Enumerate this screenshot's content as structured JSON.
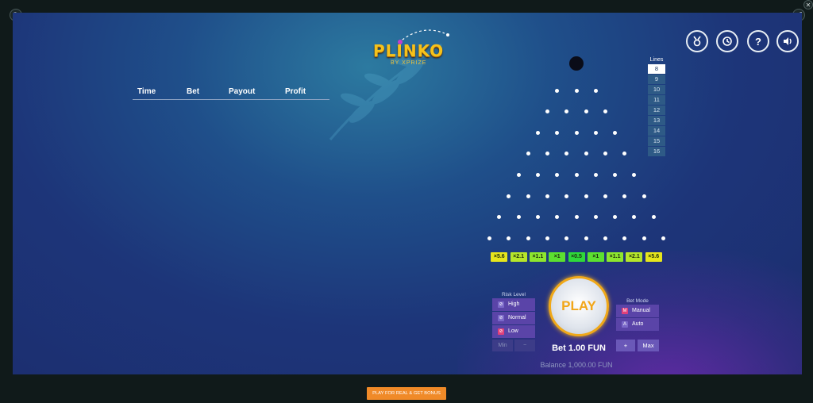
{
  "logo": {
    "title": "PLINKO",
    "subtitle": "BY XPRIZE"
  },
  "history": {
    "columns": [
      "Time",
      "Bet",
      "Payout",
      "Profit"
    ]
  },
  "hud": {
    "achievements": "medal-icon",
    "history": "clock-icon",
    "help": "?",
    "sound": "speaker-icon"
  },
  "lines": {
    "title": "Lines",
    "options": [
      "8",
      "9",
      "10",
      "11",
      "12",
      "13",
      "14",
      "15",
      "16"
    ],
    "selected": "8"
  },
  "board": {
    "rows": 8,
    "multipliers": [
      "×5.6",
      "×2.1",
      "×1.1",
      "×1",
      "×0.5",
      "×1",
      "×1.1",
      "×2.1",
      "×5.6"
    ],
    "multiplier_colors": [
      "#e6e61c",
      "#b6e62a",
      "#8ee62e",
      "#5ce030",
      "#2fd83a",
      "#5ce030",
      "#8ee62e",
      "#b6e62a",
      "#e6e61c"
    ]
  },
  "risk": {
    "title": "Risk Level",
    "options": [
      "High",
      "Normal",
      "Low"
    ],
    "selected": "Low"
  },
  "bet_controls": {
    "min_label": "Min",
    "minus_label": "−",
    "plus_label": "+",
    "max_label": "Max"
  },
  "play": {
    "label": "PLAY"
  },
  "bet": {
    "text": "Bet 1.00 FUN"
  },
  "balance": {
    "text": "Balance 1,000.00 FUN"
  },
  "mode": {
    "title": "Bet Mode",
    "options": [
      "Manual",
      "Auto"
    ],
    "selected": "Manual"
  },
  "footer": {
    "real_button": "PLAY FOR REAL & GET BONUS"
  },
  "colors": {
    "accent": "#f0a818",
    "panel": "#5a44a8",
    "real_button": "#f08a28"
  }
}
